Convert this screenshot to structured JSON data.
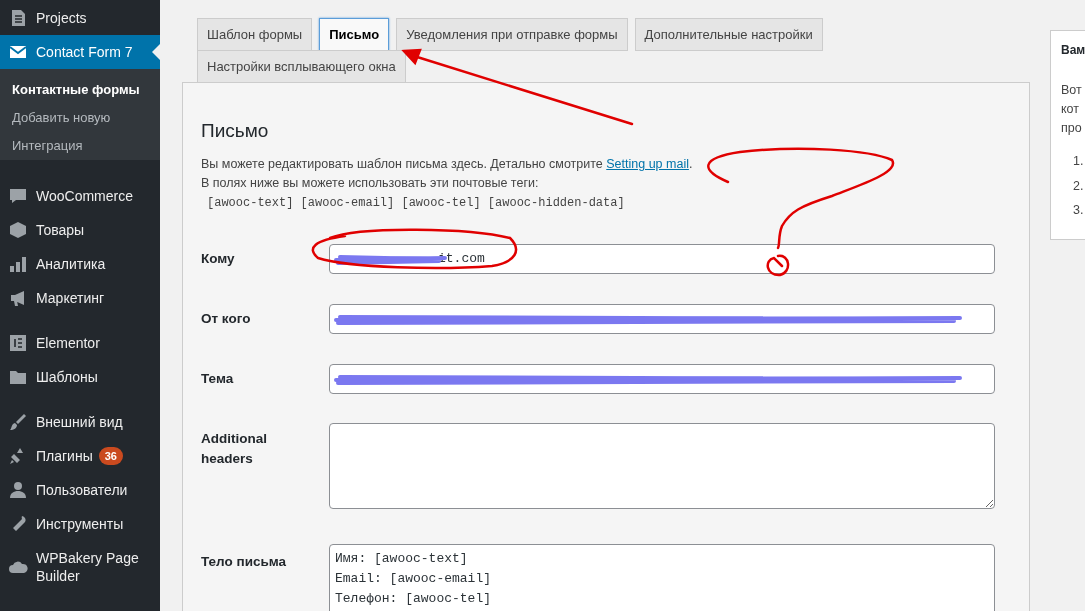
{
  "sidebar": {
    "groups": [
      [
        {
          "label": "Projects",
          "selected": false
        },
        {
          "label": "Contact Form 7",
          "selected": true,
          "submenu": [
            {
              "label": "Контактные формы",
              "selected": true
            },
            {
              "label": "Добавить новую",
              "selected": false
            },
            {
              "label": "Интеграция",
              "selected": false
            }
          ]
        }
      ],
      [
        {
          "label": "WooCommerce",
          "selected": false
        },
        {
          "label": "Товары",
          "selected": false
        },
        {
          "label": "Аналитика",
          "selected": false
        },
        {
          "label": "Маркетинг",
          "selected": false
        }
      ],
      [
        {
          "label": "Elementor",
          "selected": false
        },
        {
          "label": "Шаблоны",
          "selected": false
        }
      ],
      [
        {
          "label": "Внешний вид",
          "selected": false
        },
        {
          "label": "Плагины",
          "selected": false,
          "badge": "36"
        },
        {
          "label": "Пользователи",
          "selected": false
        },
        {
          "label": "Инструменты",
          "selected": false
        },
        {
          "label": "WPBakery Page Builder",
          "selected": false
        }
      ]
    ]
  },
  "tabs": [
    {
      "label": "Шаблон формы",
      "selected": false
    },
    {
      "label": "Письмо",
      "selected": true
    },
    {
      "label": "Уведомления при отправке формы",
      "selected": false
    },
    {
      "label": "Дополнительные настройки",
      "selected": false
    },
    {
      "label": "Настройки всплывающего окна",
      "selected": false
    }
  ],
  "panel": {
    "title": "Письмо",
    "description": {
      "text": "Вы можете редактировать шаблон письма здесь. Детально смотрите ",
      "link": "Setting up mail",
      "after": "."
    },
    "tags_intro": "В полях ниже вы можете использовать эти почтовые теги:",
    "tags": "[awooc-text] [awooc-email] [awooc-tel] [awooc-hidden-data]",
    "fields": [
      {
        "label": "Кому",
        "kind": "input",
        "value": "it.com",
        "redacted": true
      },
      {
        "label": "От кого",
        "kind": "input",
        "redacted": true
      },
      {
        "label": "Тема",
        "kind": "input",
        "redacted": true
      },
      {
        "label": "Additional headers",
        "kind": "textarea"
      },
      {
        "label": "Тело письма",
        "kind": "body",
        "lines": [
          "Имя: [awooc-text]",
          "Email: [awooc-email]",
          "Телефон: [awooc-tel]"
        ]
      }
    ]
  },
  "side_box": {
    "title": "Вам",
    "lines": [
      "Вот",
      "кот",
      "про"
    ],
    "list": [
      "1.",
      "2.",
      "3."
    ]
  }
}
